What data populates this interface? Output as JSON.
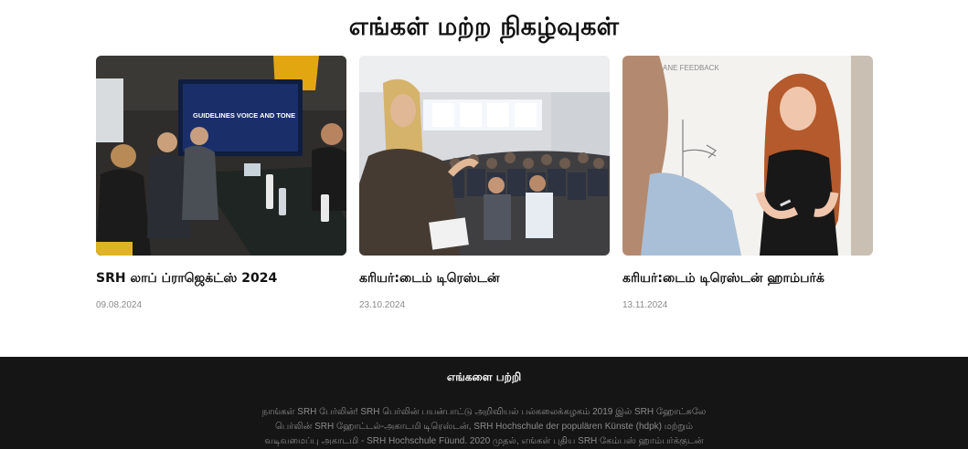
{
  "section": {
    "title": "எங்கள் மற்ற நிகழ்வுகள்"
  },
  "events": [
    {
      "title": "SRH லாப் ப்ராஜெக்ட்ஸ் 2024",
      "date": "09.08.2024",
      "screen_text": "GUIDELINES VOICE AND TONE"
    },
    {
      "title": "கரியர்:டைம் டிரெஸ்டன்",
      "date": "23.10.2024"
    },
    {
      "title": "கரியர்:டைம் டிரெஸ்டன் ஹாம்பர்க்",
      "date": "13.11.2024"
    }
  ],
  "footer": {
    "heading": "எங்களை பற்றி",
    "lines": [
      "நாங்கள் SRH பேர்லின்! SRH பெர்லின் பயன்பாட்டு அறிவியல் பல்கலைக்கழகம் 2019 இல் SRH ஹோட்சுலே",
      "பெர்லின் SRH ஹோட்டல்-அகாடமி டிரெஸ்டன், SRH Hochschule der populären Künste (hdpk) மற்றும்",
      "வடிவமைப்பு அகாடமி - SRH Hochschule Füund. 2020 முதல், எங்கள் புதிய SRH கேம்பஸ் ஹாம்பர்க்குடன்"
    ]
  },
  "colors": {
    "footer_bg": "#151515",
    "date_text": "#8a8a8a",
    "title_text": "#111111"
  }
}
